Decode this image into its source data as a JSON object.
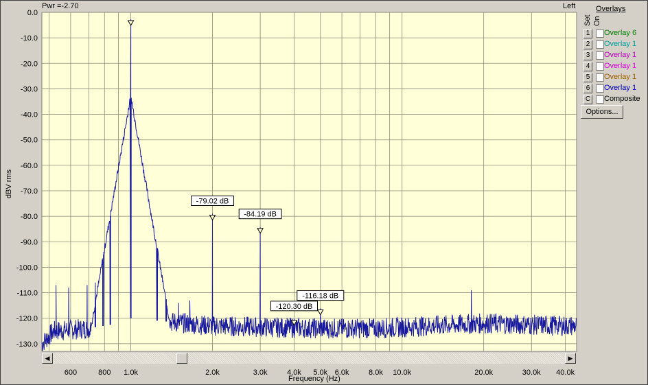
{
  "header": {
    "power_readout": "Pwr =-2.70",
    "channel": "Left"
  },
  "overlays_panel": {
    "title": "Overlays",
    "set_header": "Set",
    "on_header": "On",
    "rows": [
      {
        "key": "1",
        "name": "Overlay 6",
        "color": "#008000",
        "checked": false
      },
      {
        "key": "2",
        "name": "Overlay 1",
        "color": "#00a0a0",
        "checked": false
      },
      {
        "key": "3",
        "name": "Overlay 1",
        "color": "#c000c0",
        "checked": false
      },
      {
        "key": "4",
        "name": "Overlay 1",
        "color": "#e000e0",
        "checked": false
      },
      {
        "key": "5",
        "name": "Overlay 1",
        "color": "#a06000",
        "checked": false
      },
      {
        "key": "6",
        "name": "Overlay 1",
        "color": "#0000c0",
        "checked": false
      },
      {
        "key": "C",
        "name": "Composite",
        "color": "#000000",
        "checked": false
      }
    ],
    "options_button": "Options..."
  },
  "chart_data": {
    "type": "line",
    "xlabel": "Frequency (Hz)",
    "ylabel": "dBV rms",
    "xscale": "log",
    "xlim": [
      470,
      44000
    ],
    "ylim": [
      -133,
      0
    ],
    "grid": true,
    "background": "#ffffd8",
    "line_color": "#1818a0",
    "x_tick_labels": [
      {
        "v": 600,
        "t": "600"
      },
      {
        "v": 800,
        "t": "800"
      },
      {
        "v": 1000,
        "t": "1.0k"
      },
      {
        "v": 2000,
        "t": "2.0k"
      },
      {
        "v": 3000,
        "t": "3.0k"
      },
      {
        "v": 4000,
        "t": "4.0k"
      },
      {
        "v": 5000,
        "t": "5.0k"
      },
      {
        "v": 6000,
        "t": "6.0k"
      },
      {
        "v": 8000,
        "t": "8.0k"
      },
      {
        "v": 10000,
        "t": "10.0k"
      },
      {
        "v": 20000,
        "t": "20.0k"
      },
      {
        "v": 30000,
        "t": "30.0k"
      },
      {
        "v": 40000,
        "t": "40.0k"
      }
    ],
    "y_tick_labels": [
      {
        "v": 0,
        "t": "0.0"
      },
      {
        "v": -10,
        "t": "-10.0"
      },
      {
        "v": -20,
        "t": "-20.0"
      },
      {
        "v": -30,
        "t": "-30.0"
      },
      {
        "v": -40,
        "t": "-40.0"
      },
      {
        "v": -50,
        "t": "-50.0"
      },
      {
        "v": -60,
        "t": "-60.0"
      },
      {
        "v": -70,
        "t": "-70.0"
      },
      {
        "v": -80,
        "t": "-80.0"
      },
      {
        "v": -90,
        "t": "-90.0"
      },
      {
        "v": -100,
        "t": "-100.0"
      },
      {
        "v": -110,
        "t": "-110.0"
      },
      {
        "v": -120,
        "t": "-120.0"
      },
      {
        "v": -130,
        "t": "-130.0"
      }
    ],
    "noise_floor": [
      [
        470,
        -130
      ],
      [
        520,
        -125
      ],
      [
        700,
        -124
      ],
      [
        900,
        -122
      ],
      [
        1000,
        -120
      ],
      [
        2000,
        -123
      ],
      [
        5000,
        -124
      ],
      [
        8000,
        -124
      ],
      [
        20000,
        -122
      ],
      [
        40000,
        -123
      ],
      [
        44000,
        -123
      ]
    ],
    "spikes": [
      {
        "x": 530,
        "y": -107
      },
      {
        "x": 590,
        "y": -108
      },
      {
        "x": 690,
        "y": -107
      },
      {
        "x": 740,
        "y": -106
      },
      {
        "x": 790,
        "y": -109
      },
      {
        "x": 840,
        "y": -111
      },
      {
        "x": 1250,
        "y": -111
      },
      {
        "x": 1350,
        "y": -113
      },
      {
        "x": 1500,
        "y": -114
      },
      {
        "x": 1650,
        "y": -113
      },
      {
        "x": 18000,
        "y": -109
      }
    ],
    "peaks": [
      {
        "x": 1000,
        "y": -2.7,
        "label": ""
      },
      {
        "x": 2000,
        "y": -79.02,
        "label": "-79.02 dB"
      },
      {
        "x": 3000,
        "y": -84.19,
        "label": "-84.19 dB"
      },
      {
        "x": 4000,
        "y": -120.3,
        "label": "-120.30 dB"
      },
      {
        "x": 5000,
        "y": -116.18,
        "label": "-116.18 dB"
      }
    ]
  }
}
